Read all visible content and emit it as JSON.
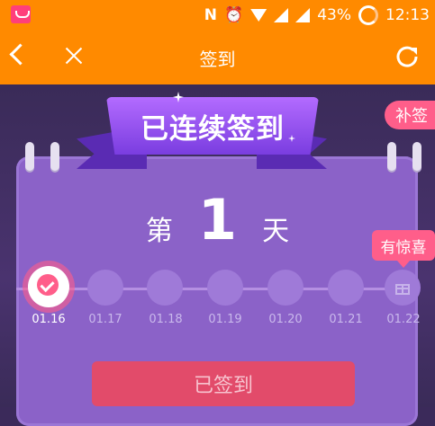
{
  "status_bar": {
    "battery": "43%",
    "time": "12:13"
  },
  "header": {
    "title": "签到"
  },
  "banner": {
    "text": "已连续签到"
  },
  "makeup_label": "补签",
  "count": {
    "prefix": "第",
    "number": "1",
    "suffix": "天"
  },
  "tooltip": "有惊喜",
  "days": [
    {
      "date": "01.16",
      "checked": true
    },
    {
      "date": "01.17",
      "checked": false
    },
    {
      "date": "01.18",
      "checked": false
    },
    {
      "date": "01.19",
      "checked": false
    },
    {
      "date": "01.20",
      "checked": false
    },
    {
      "date": "01.21",
      "checked": false
    },
    {
      "date": "01.22",
      "checked": false
    }
  ],
  "signed_button": "已签到",
  "colors": {
    "header": "#ff8a00",
    "card": "#8b62c8",
    "accent": "#ff5e8a",
    "button": "#e24b6a"
  }
}
